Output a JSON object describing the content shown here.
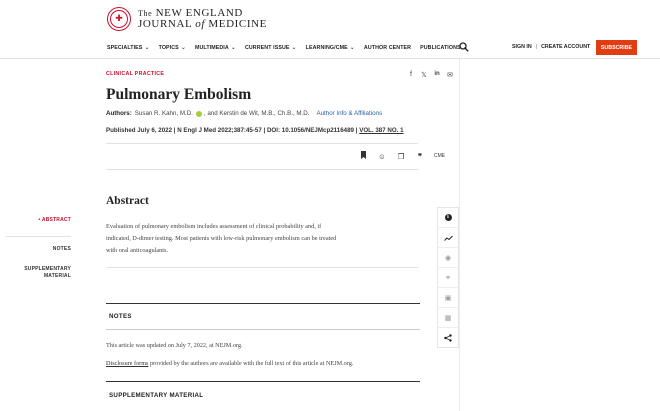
{
  "brand": {
    "the": "The",
    "line1": "NEW ENGLAND",
    "line2_a": "JOURNAL",
    "line2_of": "of",
    "line2_b": "MEDICINE",
    "accent_color": "#c8102e"
  },
  "nav": {
    "items": [
      {
        "label": "SPECIALTIES",
        "dropdown": true
      },
      {
        "label": "TOPICS",
        "dropdown": true
      },
      {
        "label": "MULTIMEDIA",
        "dropdown": true
      },
      {
        "label": "CURRENT ISSUE",
        "dropdown": true
      },
      {
        "label": "LEARNING/CME",
        "dropdown": true
      },
      {
        "label": "AUTHOR CENTER",
        "dropdown": false
      },
      {
        "label": "PUBLICATIONS",
        "dropdown": true
      }
    ],
    "signin": "SIGN IN",
    "create_account": "CREATE ACCOUNT",
    "subscribe": "SUBSCRIBE",
    "subscribe_color": "#e23c12"
  },
  "article": {
    "category": "CLINICAL PRACTICE",
    "title": "Pulmonary Embolism",
    "authors_label": "Authors:",
    "author1": "Susan R. Kahn, M.D.",
    "author2": ", and Kerstin de Wit, M.B., Ch.B., M.D.",
    "affiliations": "Author Info & Affiliations",
    "published": "Published July 6, 2022 | N Engl J Med 2022;387:45-57 | DOI: 10.1056/NEJMcp2116489 |",
    "volume": "VOL. 387 NO. 1",
    "cme": "CME"
  },
  "abstract": {
    "heading": "Abstract",
    "line1": "Evaluation of pulmonary embolism includes assessment of clinical probability and, if",
    "line2": "indicated, D-dimer testing. Most patients with low-risk pulmonary embolism can be treated",
    "line3": "with oral anticoagulants."
  },
  "left_nav": {
    "abstract": "ABSTRACT",
    "notes": "NOTES",
    "supp_line1": "SUPPLEMENTARY",
    "supp_line2": "MATERIAL"
  },
  "notes": {
    "heading": "NOTES",
    "note1": "This article was updated on July 7, 2022, at NEJM.org.",
    "note2_link": "Disclosure forms",
    "note2_rest": " provided by the authors are available with the full text of this article at NEJM.org."
  },
  "supplementary": {
    "heading": "SUPPLEMENTARY MATERIAL"
  }
}
